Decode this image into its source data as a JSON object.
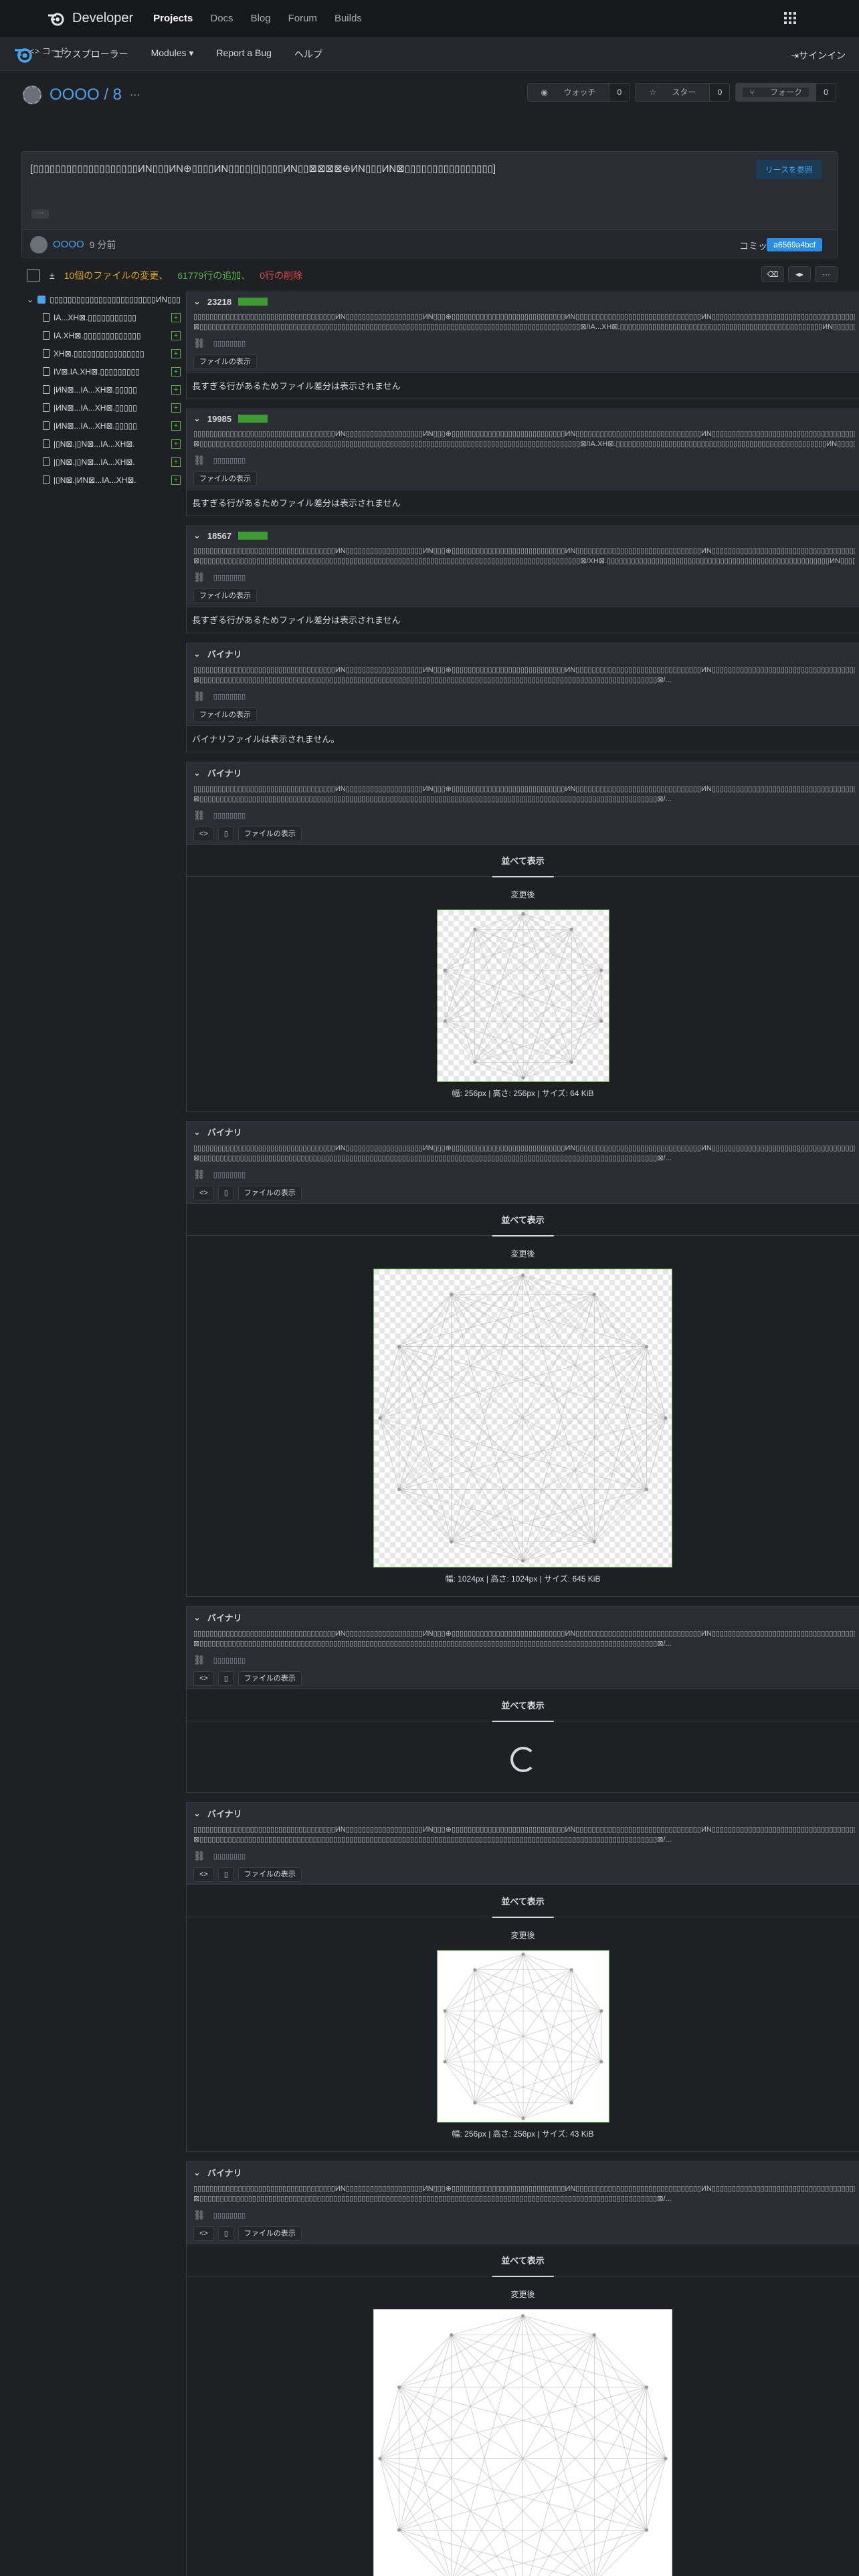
{
  "topbar": {
    "brand": "Developer",
    "nav": [
      "Projects",
      "Docs",
      "Blog",
      "Forum",
      "Builds"
    ]
  },
  "subnav": {
    "items": [
      "エクスプローラー",
      "Modules ▾",
      "Report a Bug",
      "ヘルプ"
    ],
    "signin": "サインイン"
  },
  "repo": {
    "title": "OOOO / 8",
    "code_tab": "<> コード",
    "watch": "ウォッチ",
    "watch_count": "0",
    "star": "スター",
    "star_count": "0",
    "fork": "フォーク",
    "fork_count": "0"
  },
  "commit": {
    "message": "[▯▯▯▯▯▯▯▯▯▯▯▯▯▯▯▯▯▯▯ИN▯▯▯ИN⊕▯▯▯▯ИN▯▯▯▯|▯|▯▯▯▯ИN▯▯⊠⊠⊠⊠⊕ИN▯▯▯ИN⊠▯▯▯▯▯▯▯▯▯▯▯▯▯▯▯▯]",
    "browse_button": "リースを参照",
    "author": "OOOO",
    "time": "9 分前",
    "commit_label": "コミット",
    "sha": "a6569a4bcf"
  },
  "stats": {
    "changed": "10個のファイルの変更、",
    "added": "61779行の追加、",
    "removed": "0行の削除"
  },
  "tree": {
    "folder": "▯▯▯▯▯▯▯▯▯▯▯▯▯▯▯▯▯▯▯▯▯▯▯▯ИN▯▯▯",
    "files": [
      "IA...XH⊠.▯▯▯▯▯▯▯▯▯▯▯",
      "IA.XH⊠.▯▯▯▯▯▯▯▯▯▯▯▯▯",
      "XH⊠.▯▯▯▯▯▯▯▯▯▯▯▯▯▯▯▯",
      "IV⊠.IA.XH⊠.▯▯▯▯▯▯▯▯▯",
      "|ИN⊠...IA...XH⊠.▯▯▯▯▯",
      "|ИN⊠...IA...XH⊠.▯▯▯▯▯",
      "|ИN⊠...IA...XH⊠.▯▯▯▯▯",
      "|▯N⊠.|▯N⊠...IA...XH⊠.",
      "|▯N⊠.|▯N⊠...IA...XH⊠.",
      "|▯N⊠.|ИN⊠...IA...XH⊠."
    ]
  },
  "diff_common": {
    "path": "▯▯▯▯▯▯▯▯▯▯▯▯▯▯▯▯▯▯▯▯▯▯▯▯▯▯▯▯▯▯▯▯▯▯▯ИN▯▯▯▯▯▯▯▯▯▯▯▯▯▯▯▯▯▯▯ИN▯▯▯⊕▯▯▯▯▯▯▯▯▯▯▯▯▯▯▯▯▯▯▯▯▯▯▯▯▯▯▯▯ИN▯▯▯▯▯▯▯▯▯▯▯▯▯▯▯▯▯▯▯▯▯▯▯▯▯▯▯▯▯▯▯ИN▯▯▯▯▯▯▯▯▯▯▯▯▯▯▯▯▯▯▯▯▯▯▯▯▯▯▯▯▯▯▯▯▯▯▯▯▯▯ИN▯▯▯▯▯▯▯▯▯▯▯▯▯▯▯▯▯▯▯▯▯▯▯▯▯⊕▯▯▯▯▯▯▯▯▯▯▯▯▯▯ИN▯▯▯▯▯▯▯▯▯▯▯▯▯ИN▯▯▯▯▯▯▯▯▯▯",
    "copy_placeholder": "▯▯▯▯▯▯▯▯",
    "view_file": "ファイルの表示",
    "side_by_side": "並べて表示",
    "after": "変更後"
  },
  "diffs": [
    {
      "count": "23218",
      "path2": "⊠▯▯▯▯▯▯▯▯▯▯▯▯▯▯▯▯▯▯▯▯▯▯▯▯▯▯▯▯▯▯▯▯▯▯▯▯▯▯▯▯▯▯▯▯▯▯▯▯▯▯▯▯▯▯▯▯▯▯▯▯▯▯▯▯▯▯▯▯▯▯▯▯▯▯▯▯▯▯▯▯▯▯▯▯▯▯▯▯▯▯▯▯▯▯⊠/IA...XH⊠.▯▯▯▯▯▯▯▯▯▯▯▯▯▯▯▯▯▯▯▯▯▯▯▯▯▯▯▯▯▯▯▯▯▯▯▯▯▯▯▯▯▯▯▯▯▯▯▯▯▯ИN▯▯▯▯▯▯▯▯ИN⊕▯▯▯▯▯▯▯▯▯▯▯▯",
      "note": "長すぎる行があるためファイル差分は表示されません"
    },
    {
      "count": "19985",
      "path2": "⊠▯▯▯▯▯▯▯▯▯▯▯▯▯▯▯▯▯▯▯▯▯▯▯▯▯▯▯▯▯▯▯▯▯▯▯▯▯▯▯▯▯▯▯▯▯▯▯▯▯▯▯▯▯▯▯▯▯▯▯▯▯▯▯▯▯▯▯▯▯▯▯▯▯▯▯▯▯▯▯▯▯▯▯▯▯▯▯▯▯▯▯▯▯▯⊠/IA.XH⊠.▯▯▯▯▯▯▯▯▯▯▯▯▯▯▯▯▯▯▯▯▯▯▯▯▯▯▯▯▯▯▯▯▯▯▯▯▯▯▯▯▯▯▯▯▯▯▯▯▯▯▯▯ИN▯▯▯▯▯▯▯▯ИN⊕▯▯▯▯▯▯▯▯▯▯▯▯",
      "note": "長すぎる行があるためファイル差分は表示されません"
    },
    {
      "count": "18567",
      "path2": "⊠▯▯▯▯▯▯▯▯▯▯▯▯▯▯▯▯▯▯▯▯▯▯▯▯▯▯▯▯▯▯▯▯▯▯▯▯▯▯▯▯▯▯▯▯▯▯▯▯▯▯▯▯▯▯▯▯▯▯▯▯▯▯▯▯▯▯▯▯▯▯▯▯▯▯▯▯▯▯▯▯▯▯▯▯▯▯▯▯▯▯▯▯▯▯⊠/XH⊠.▯▯▯▯▯▯▯▯▯▯▯▯▯▯▯▯▯▯▯▯▯▯▯▯▯▯▯▯▯▯▯▯▯▯▯▯▯▯▯▯▯▯▯▯▯▯▯▯▯▯▯▯▯▯▯ИN▯▯▯▯▯▯▯▯ИN⊕▯▯▯▯▯▯▯▯▯▯▯▯",
      "note": "長すぎる行があるためファイル差分は表示されません"
    },
    {
      "count": "バイナリ",
      "path2": "⊠▯▯▯▯▯▯▯▯▯▯▯▯▯▯▯▯▯▯▯▯▯▯▯▯▯▯▯▯▯▯▯▯▯▯▯▯▯▯▯▯▯▯▯▯▯▯▯▯▯▯▯▯▯▯▯▯▯▯▯▯▯▯▯▯▯▯▯▯▯▯▯▯▯▯▯▯▯▯▯▯▯▯▯▯▯▯▯▯▯▯▯▯▯▯▯▯▯▯▯▯▯▯▯▯▯▯▯▯▯▯▯▯▯⊠/...",
      "note": "バイナリファイルは表示されません。"
    },
    {
      "count": "バイナリ",
      "path2": "⊠▯▯▯▯▯▯▯▯▯▯▯▯▯▯▯▯▯▯▯▯▯▯▯▯▯▯▯▯▯▯▯▯▯▯▯▯▯▯▯▯▯▯▯▯▯▯▯▯▯▯▯▯▯▯▯▯▯▯▯▯▯▯▯▯▯▯▯▯▯▯▯▯▯▯▯▯▯▯▯▯▯▯▯▯▯▯▯▯▯▯▯▯▯▯▯▯▯▯▯▯▯▯▯▯▯▯▯▯▯▯▯▯▯⊠/...",
      "meta": "幅: 256px | 高さ: 256px | サイズ: 64 KiB",
      "poly": 10,
      "checker": true,
      "frame": true
    },
    {
      "count": "バイナリ",
      "path2": "⊠▯▯▯▯▯▯▯▯▯▯▯▯▯▯▯▯▯▯▯▯▯▯▯▯▯▯▯▯▯▯▯▯▯▯▯▯▯▯▯▯▯▯▯▯▯▯▯▯▯▯▯▯▯▯▯▯▯▯▯▯▯▯▯▯▯▯▯▯▯▯▯▯▯▯▯▯▯▯▯▯▯▯▯▯▯▯▯▯▯▯▯▯▯▯▯▯▯▯▯▯▯▯▯▯▯▯▯▯▯▯▯▯▯⊠/...",
      "meta": "幅: 1024px | 高さ: 1024px | サイズ: 645 KiB",
      "poly": 12,
      "checker": true,
      "frame": true
    },
    {
      "count": "バイナリ",
      "path2": "⊠▯▯▯▯▯▯▯▯▯▯▯▯▯▯▯▯▯▯▯▯▯▯▯▯▯▯▯▯▯▯▯▯▯▯▯▯▯▯▯▯▯▯▯▯▯▯▯▯▯▯▯▯▯▯▯▯▯▯▯▯▯▯▯▯▯▯▯▯▯▯▯▯▯▯▯▯▯▯▯▯▯▯▯▯▯▯▯▯▯▯▯▯▯▯▯▯▯▯▯▯▯▯▯▯▯▯▯▯▯▯▯▯▯⊠/...",
      "loading": true
    },
    {
      "count": "バイナリ",
      "path2": "⊠▯▯▯▯▯▯▯▯▯▯▯▯▯▯▯▯▯▯▯▯▯▯▯▯▯▯▯▯▯▯▯▯▯▯▯▯▯▯▯▯▯▯▯▯▯▯▯▯▯▯▯▯▯▯▯▯▯▯▯▯▯▯▯▯▯▯▯▯▯▯▯▯▯▯▯▯▯▯▯▯▯▯▯▯▯▯▯▯▯▯▯▯▯▯▯▯▯▯▯▯▯▯▯▯▯▯▯▯▯▯▯▯▯⊠/...",
      "meta": "幅: 256px | 高さ: 256px | サイズ: 43 KiB",
      "poly": 10,
      "checker": false,
      "frame": true
    },
    {
      "count": "バイナリ",
      "path2": "⊠▯▯▯▯▯▯▯▯▯▯▯▯▯▯▯▯▯▯▯▯▯▯▯▯▯▯▯▯▯▯▯▯▯▯▯▯▯▯▯▯▯▯▯▯▯▯▯▯▯▯▯▯▯▯▯▯▯▯▯▯▯▯▯▯▯▯▯▯▯▯▯▯▯▯▯▯▯▯▯▯▯▯▯▯▯▯▯▯▯▯▯▯▯▯▯▯▯▯▯▯▯▯▯▯▯▯▯▯▯▯▯▯▯⊠/...",
      "meta": "",
      "poly": 12,
      "checker": false,
      "frame": false
    }
  ]
}
